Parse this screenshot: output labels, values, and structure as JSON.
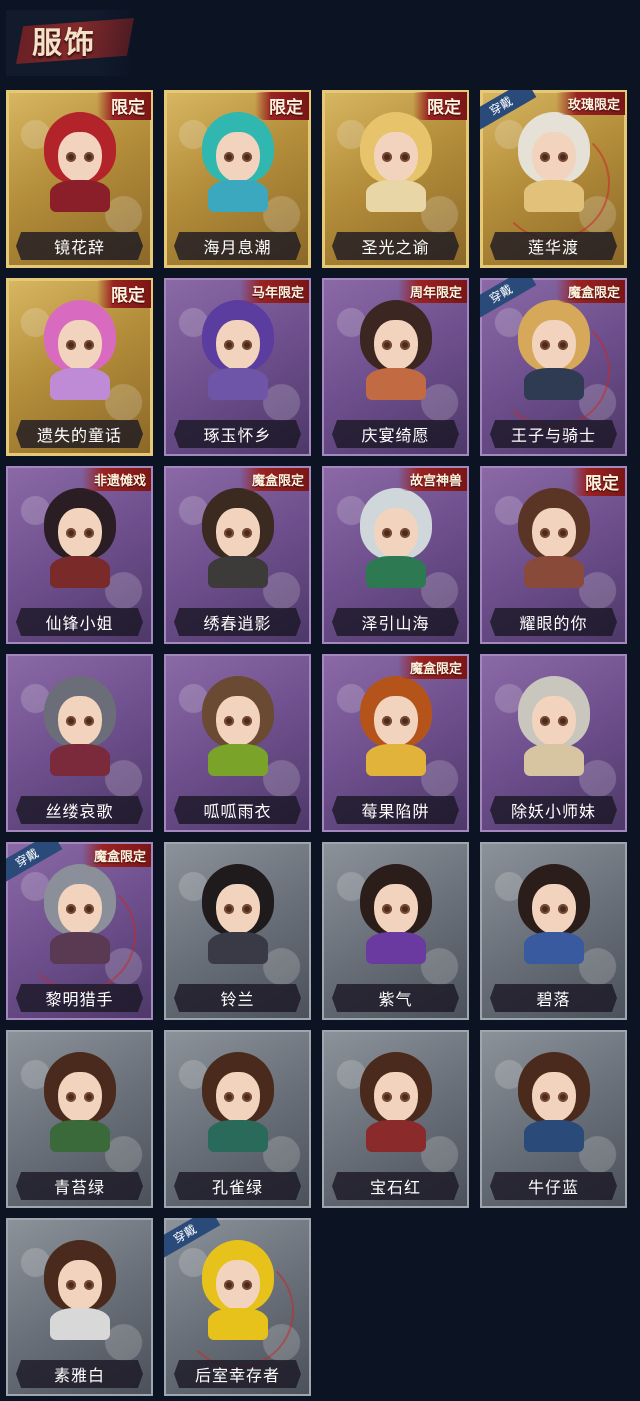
{
  "header": {
    "title": "服饰"
  },
  "cards": [
    {
      "name": "镜花辞",
      "badge": "限定",
      "theme": "gold",
      "hair": "#b2232a",
      "body": "#8a1f2a"
    },
    {
      "name": "海月息潮",
      "badge": "限定",
      "theme": "gold",
      "hair": "#2fb7b0",
      "body": "#3ca8c0"
    },
    {
      "name": "圣光之谕",
      "badge": "限定",
      "theme": "gold",
      "hair": "#e7c46b",
      "body": "#e9d6a6"
    },
    {
      "name": "莲华渡",
      "badge": "玫瑰限定",
      "theme": "gold",
      "wear": "穿戴",
      "hair": "#e6e1d6",
      "body": "#e2c27a"
    },
    {
      "name": "遗失的童话",
      "badge": "限定",
      "theme": "gold",
      "hair": "#d86bbf",
      "body": "#c08bd6"
    },
    {
      "name": "琢玉怀乡",
      "badge": "马年限定",
      "theme": "purple",
      "hair": "#5b3da0",
      "body": "#6e55a8"
    },
    {
      "name": "庆宴绮愿",
      "badge": "周年限定",
      "theme": "purple",
      "hair": "#3b2621",
      "body": "#c26b43"
    },
    {
      "name": "王子与骑士",
      "badge": "魔盒限定",
      "theme": "purple",
      "wear": "穿戴",
      "hair": "#d6a85a",
      "body": "#2f3b53"
    },
    {
      "name": "仙锋小姐",
      "badge": "非遗傩戏",
      "theme": "purple",
      "hair": "#2a1d24",
      "body": "#7b2a2a"
    },
    {
      "name": "绣春逍影",
      "badge": "魔盒限定",
      "theme": "purple",
      "hair": "#3a2a20",
      "body": "#3d3a3a"
    },
    {
      "name": "泽引山海",
      "badge": "故宫神兽",
      "theme": "purple",
      "hair": "#cfd7da",
      "body": "#2d7a52"
    },
    {
      "name": "耀眼的你",
      "badge": "限定",
      "theme": "purple",
      "hair": "#5a3526",
      "body": "#8a4a3a"
    },
    {
      "name": "丝缕哀歌",
      "badge": "",
      "theme": "purple",
      "hair": "#6b6d78",
      "body": "#7a2a3a"
    },
    {
      "name": "呱呱雨衣",
      "badge": "",
      "theme": "purple",
      "hair": "#6b4a33",
      "body": "#7aa32a"
    },
    {
      "name": "莓果陷阱",
      "badge": "魔盒限定",
      "theme": "purple",
      "hair": "#b4541b",
      "body": "#e2b33a"
    },
    {
      "name": "除妖小师妹",
      "badge": "",
      "theme": "purple",
      "hair": "#c9c6be",
      "body": "#d7c4a0"
    },
    {
      "name": "黎明猎手",
      "badge": "魔盒限定",
      "theme": "purple",
      "wear": "穿戴",
      "hair": "#8a8f99",
      "body": "#5a3a52"
    },
    {
      "name": "铃兰",
      "badge": "",
      "theme": "grey",
      "hair": "#1f1a1c",
      "body": "#3a3a46"
    },
    {
      "name": "紫气",
      "badge": "",
      "theme": "grey",
      "hair": "#2a1d1a",
      "body": "#6a3aa0"
    },
    {
      "name": "碧落",
      "badge": "",
      "theme": "grey",
      "hair": "#2a1d1a",
      "body": "#3a5aa0"
    },
    {
      "name": "青苔绿",
      "badge": "",
      "theme": "grey",
      "hair": "#4a2a1c",
      "body": "#3a6a3a"
    },
    {
      "name": "孔雀绿",
      "badge": "",
      "theme": "grey",
      "hair": "#4a2a1c",
      "body": "#2a6a5a"
    },
    {
      "name": "宝石红",
      "badge": "",
      "theme": "grey",
      "hair": "#4a2a1c",
      "body": "#8a2a2a"
    },
    {
      "name": "牛仔蓝",
      "badge": "",
      "theme": "grey",
      "hair": "#4a2a1c",
      "body": "#2a4a7a"
    },
    {
      "name": "素雅白",
      "badge": "",
      "theme": "grey",
      "hair": "#4a2a1c",
      "body": "#d8d8d8"
    },
    {
      "name": "后室幸存者",
      "badge": "",
      "theme": "grey",
      "wear": "穿戴",
      "hair": "#e6c21a",
      "body": "#e6c21a"
    }
  ]
}
